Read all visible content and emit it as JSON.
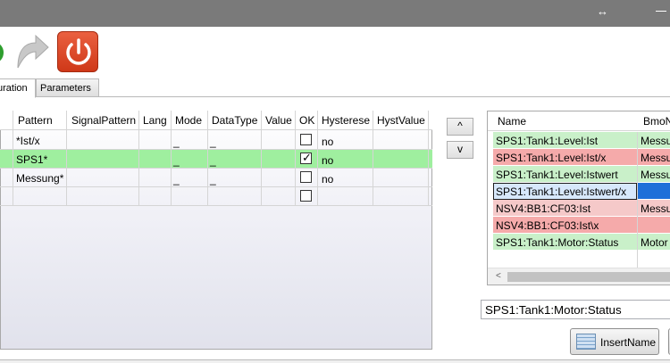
{
  "window": {
    "resize_glyph": "↔"
  },
  "toolbar": {
    "icons": [
      "run-icon",
      "redo-icon",
      "power-icon"
    ],
    "colors": {
      "power": "#d9401f",
      "run": "#2e9e2e"
    }
  },
  "tabs": [
    {
      "label": "uration",
      "active": true
    },
    {
      "label": "Parameters",
      "active": false
    }
  ],
  "grid": {
    "columns": [
      "Pattern",
      "SignalPattern",
      "Lang",
      "Mode",
      "DataType",
      "Value",
      "OK",
      "Hysterese",
      "HystValue"
    ],
    "rows": [
      {
        "pattern": "*Ist/x",
        "mode": "_",
        "datatype": "_",
        "ok": false,
        "hysterese": "no",
        "selected": false
      },
      {
        "pattern": "SPS1*",
        "mode": "_",
        "datatype": "_",
        "ok": true,
        "hysterese": "no",
        "selected": true
      },
      {
        "pattern": "Messung*",
        "mode": "_",
        "datatype": "_",
        "ok": false,
        "hysterese": "no",
        "selected": false
      },
      {
        "pattern": "",
        "mode": "",
        "datatype": "",
        "ok": false,
        "hysterese": "",
        "selected": false
      }
    ]
  },
  "move_buttons": {
    "up": "^",
    "down": "v"
  },
  "list": {
    "columns": [
      "Name",
      "BmoN"
    ],
    "rows": [
      {
        "name": "SPS1:Tank1:Level:Ist",
        "bmo": "Messu",
        "status": "green"
      },
      {
        "name": "SPS1:Tank1:Level:Ist/x",
        "bmo": "Messu",
        "status": "red"
      },
      {
        "name": "SPS1:Tank1:Level:Istwert",
        "bmo": "Messu",
        "status": "green"
      },
      {
        "name": "SPS1:Tank1:Level:Istwert/x",
        "bmo": "",
        "status": "selected"
      },
      {
        "name": "NSV4:BB1:CF03:Ist",
        "bmo": "Messu",
        "status": "pink"
      },
      {
        "name": "NSV4:BB1:CF03:Ist\\x",
        "bmo": "",
        "status": "red"
      },
      {
        "name": "SPS1:Tank1:Motor:Status",
        "bmo": "Motor",
        "status": "green"
      }
    ]
  },
  "name_field": {
    "value": "SPS1:Tank1:Motor:Status"
  },
  "insert_button": {
    "label": "InsertName"
  }
}
